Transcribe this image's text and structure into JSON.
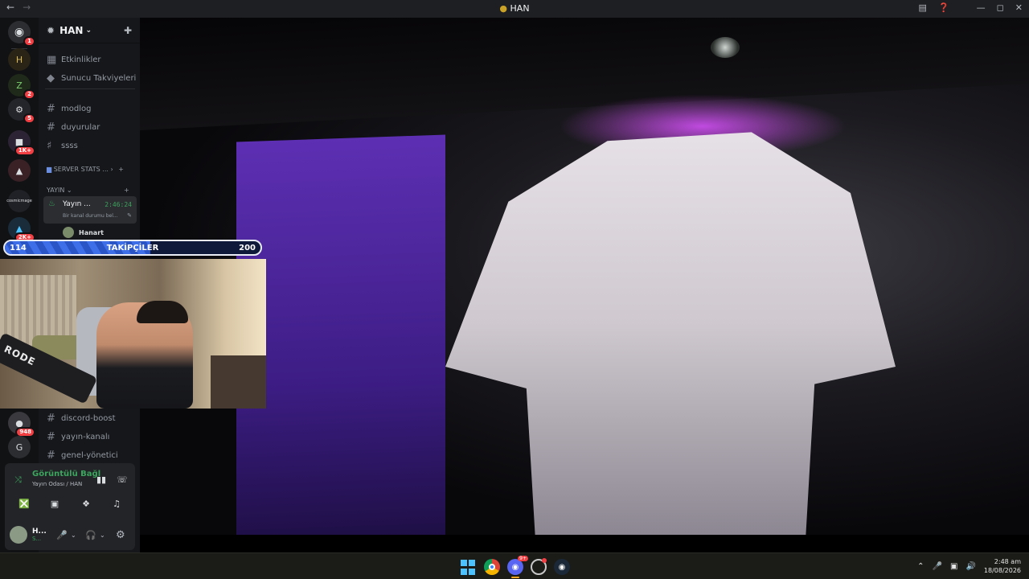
{
  "titlebar": {
    "title": "HAN",
    "back_icon": "arrow-left-icon",
    "forward_icon": "arrow-right-icon"
  },
  "servers": {
    "home_badge": "1",
    "items": [
      {
        "badge": ""
      },
      {
        "badge": "2"
      },
      {
        "badge": "5"
      },
      {
        "badge": "1K+"
      },
      {
        "badge": ""
      },
      {
        "label": "cosmicmage"
      },
      {
        "badge": "2K+"
      },
      {
        "badge": "948"
      },
      {
        "label": "G"
      }
    ]
  },
  "channels": {
    "guild_name": "HAN",
    "events": "Etkinlikler",
    "boosts": "Sunucu Takviyeleri",
    "text_channels": [
      "modlog",
      "duyurular",
      "ssss"
    ],
    "category_server_stats": "SERVER STATS ...",
    "category_yayin": "YAYIN",
    "voice_channel": {
      "name": "Yayın ...",
      "timer": "2:46:24",
      "status": "Bir kanal durumu bel...",
      "member": "Hanart"
    },
    "lower_channels": [
      "discord-boost",
      "yayın-kanalı",
      "genel-yönetici"
    ]
  },
  "voice_panel": {
    "title": "Görüntülü Bağl",
    "subtitle": "Yayın Odası / HAN"
  },
  "user": {
    "name": "H...",
    "status": "S..."
  },
  "overlay": {
    "followers_current": "114",
    "followers_label": "TAKİPÇİLER",
    "followers_goal": "200",
    "followers_fraction": 0.57,
    "mic_brand": "RODE"
  },
  "taskbar": {
    "discord_badge": "9+",
    "time": "2:48 am",
    "date": "18/08/2026"
  },
  "colors": {
    "accent_green": "#3ba55d",
    "badge_red": "#f23f43",
    "follow_bar": "#3e6ee8"
  }
}
